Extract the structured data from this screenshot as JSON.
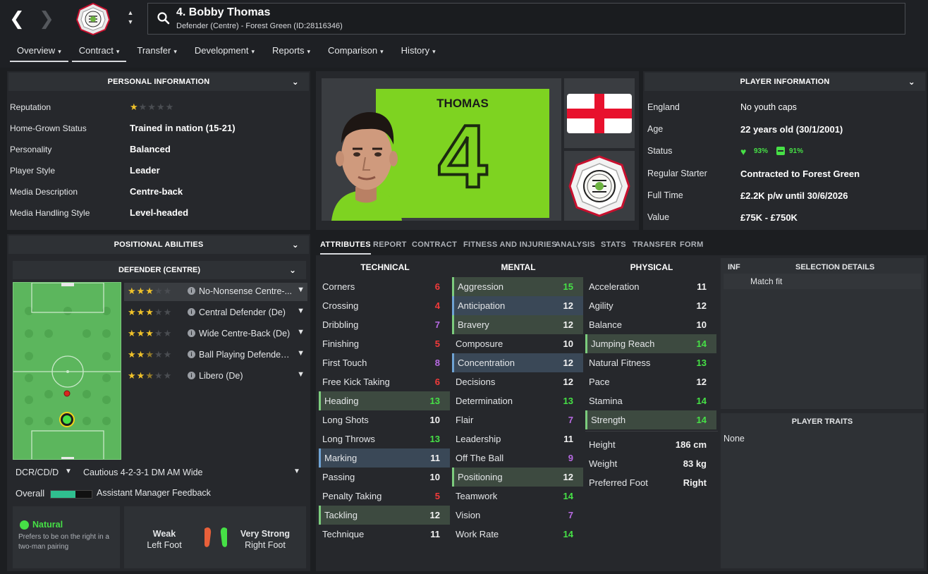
{
  "header": {
    "back_label": "❮",
    "forward_label": "❯",
    "player_title": "4. Bobby Thomas",
    "player_subtitle": "Defender (Centre) - Forest Green (ID:28116346)"
  },
  "tabs": [
    {
      "label": "Overview"
    },
    {
      "label": "Contract"
    },
    {
      "label": "Transfer"
    },
    {
      "label": "Development"
    },
    {
      "label": "Reports"
    },
    {
      "label": "Comparison"
    },
    {
      "label": "History"
    }
  ],
  "personal": {
    "title": "PERSONAL INFORMATION",
    "rows": [
      {
        "label": "Reputation",
        "stars": 1
      },
      {
        "label": "Home-Grown Status",
        "value": "Trained in nation (15-21)"
      },
      {
        "label": "Personality",
        "value": "Balanced"
      },
      {
        "label": "Player Style",
        "value": "Leader"
      },
      {
        "label": "Media Description",
        "value": "Centre-back"
      },
      {
        "label": "Media Handling Style",
        "value": "Level-headed"
      }
    ]
  },
  "kit": {
    "name": "THOMAS",
    "number": "4"
  },
  "player_info": {
    "title": "PLAYER INFORMATION",
    "nation": "England",
    "youth_caps": "No youth caps",
    "age_label": "Age",
    "age": "22 years old (30/1/2001)",
    "status_label": "Status",
    "status_morale": "93%",
    "status_fitness": "91%",
    "regular_label": "Regular Starter",
    "regular_value": "Contracted to Forest Green",
    "fulltime_label": "Full Time",
    "fulltime_value": "£2.2K p/w until 30/6/2026",
    "value_label": "Value",
    "value_value": "£75K - £750K"
  },
  "positional": {
    "title": "POSITIONAL ABILITIES",
    "position": "DEFENDER (CENTRE)",
    "roles": [
      {
        "name": "No-Nonsense Centre-...",
        "stars": 3
      },
      {
        "name": "Central Defender (De)",
        "stars": 3
      },
      {
        "name": "Wide Centre-Back (De)",
        "stars": 3
      },
      {
        "name": "Ball Playing Defender (...",
        "stars": 2.5
      },
      {
        "name": "Libero (De)",
        "stars": 2.5
      }
    ],
    "position_select": "DCR/CD/D",
    "tactic_select": "Cautious 4-2-3-1 DM AM Wide",
    "overall_label": "Overall",
    "overall_level": 0.6,
    "feedback_label": "Assistant Manager Feedback",
    "natural_label": "Natural",
    "natural_desc": "Prefers to be on the right in a two-man pairing",
    "left_foot_rating": "Weak",
    "left_foot_label": "Left Foot",
    "right_foot_rating": "Very Strong",
    "right_foot_label": "Right Foot"
  },
  "subtabs": [
    "ATTRIBUTES",
    "REPORT",
    "CONTRACT",
    "FITNESS AND INJURIES",
    "ANALYSIS",
    "STATS",
    "TRANSFER",
    "FORM"
  ],
  "attributes": {
    "technical_title": "TECHNICAL",
    "mental_title": "MENTAL",
    "physical_title": "PHYSICAL",
    "technical": [
      {
        "name": "Corners",
        "value": "6",
        "color": "r"
      },
      {
        "name": "Crossing",
        "value": "4",
        "color": "r"
      },
      {
        "name": "Dribbling",
        "value": "7",
        "color": "p"
      },
      {
        "name": "Finishing",
        "value": "5",
        "color": "r"
      },
      {
        "name": "First Touch",
        "value": "8",
        "color": "p"
      },
      {
        "name": "Free Kick Taking",
        "value": "6",
        "color": "r"
      },
      {
        "name": "Heading",
        "value": "13",
        "color": "g",
        "hl": "g"
      },
      {
        "name": "Long Shots",
        "value": "10",
        "color": "w"
      },
      {
        "name": "Long Throws",
        "value": "13",
        "color": "g"
      },
      {
        "name": "Marking",
        "value": "11",
        "color": "w",
        "hl": "b"
      },
      {
        "name": "Passing",
        "value": "10",
        "color": "w"
      },
      {
        "name": "Penalty Taking",
        "value": "5",
        "color": "r"
      },
      {
        "name": "Tackling",
        "value": "12",
        "color": "w",
        "hl": "g"
      },
      {
        "name": "Technique",
        "value": "11",
        "color": "w"
      }
    ],
    "mental": [
      {
        "name": "Aggression",
        "value": "15",
        "color": "g",
        "hl": "g"
      },
      {
        "name": "Anticipation",
        "value": "12",
        "color": "w",
        "hl": "b"
      },
      {
        "name": "Bravery",
        "value": "12",
        "color": "w",
        "hl": "g"
      },
      {
        "name": "Composure",
        "value": "10",
        "color": "w"
      },
      {
        "name": "Concentration",
        "value": "12",
        "color": "w",
        "hl": "b"
      },
      {
        "name": "Decisions",
        "value": "12",
        "color": "w"
      },
      {
        "name": "Determination",
        "value": "13",
        "color": "g"
      },
      {
        "name": "Flair",
        "value": "7",
        "color": "p"
      },
      {
        "name": "Leadership",
        "value": "11",
        "color": "w"
      },
      {
        "name": "Off The Ball",
        "value": "9",
        "color": "p"
      },
      {
        "name": "Positioning",
        "value": "12",
        "color": "w",
        "hl": "g"
      },
      {
        "name": "Teamwork",
        "value": "14",
        "color": "g"
      },
      {
        "name": "Vision",
        "value": "7",
        "color": "p"
      },
      {
        "name": "Work Rate",
        "value": "14",
        "color": "g"
      }
    ],
    "physical": [
      {
        "name": "Acceleration",
        "value": "11",
        "color": "w"
      },
      {
        "name": "Agility",
        "value": "12",
        "color": "w"
      },
      {
        "name": "Balance",
        "value": "10",
        "color": "w"
      },
      {
        "name": "Jumping Reach",
        "value": "14",
        "color": "g",
        "hl": "g"
      },
      {
        "name": "Natural Fitness",
        "value": "13",
        "color": "g"
      },
      {
        "name": "Pace",
        "value": "12",
        "color": "w"
      },
      {
        "name": "Stamina",
        "value": "14",
        "color": "g"
      },
      {
        "name": "Strength",
        "value": "14",
        "color": "g",
        "hl": "g"
      }
    ],
    "bio": [
      {
        "name": "Height",
        "value": "186 cm"
      },
      {
        "name": "Weight",
        "value": "83 kg"
      },
      {
        "name": "Preferred Foot",
        "value": "Right"
      }
    ]
  },
  "selection": {
    "inf_label": "INF",
    "title": "SELECTION DETAILS",
    "item": "Match fit"
  },
  "traits": {
    "title": "PLAYER TRAITS",
    "value": "None"
  },
  "colors": {
    "accent_green": "#46e046",
    "kit_green": "#7ed321",
    "pitch_green": "#5cb65d"
  }
}
